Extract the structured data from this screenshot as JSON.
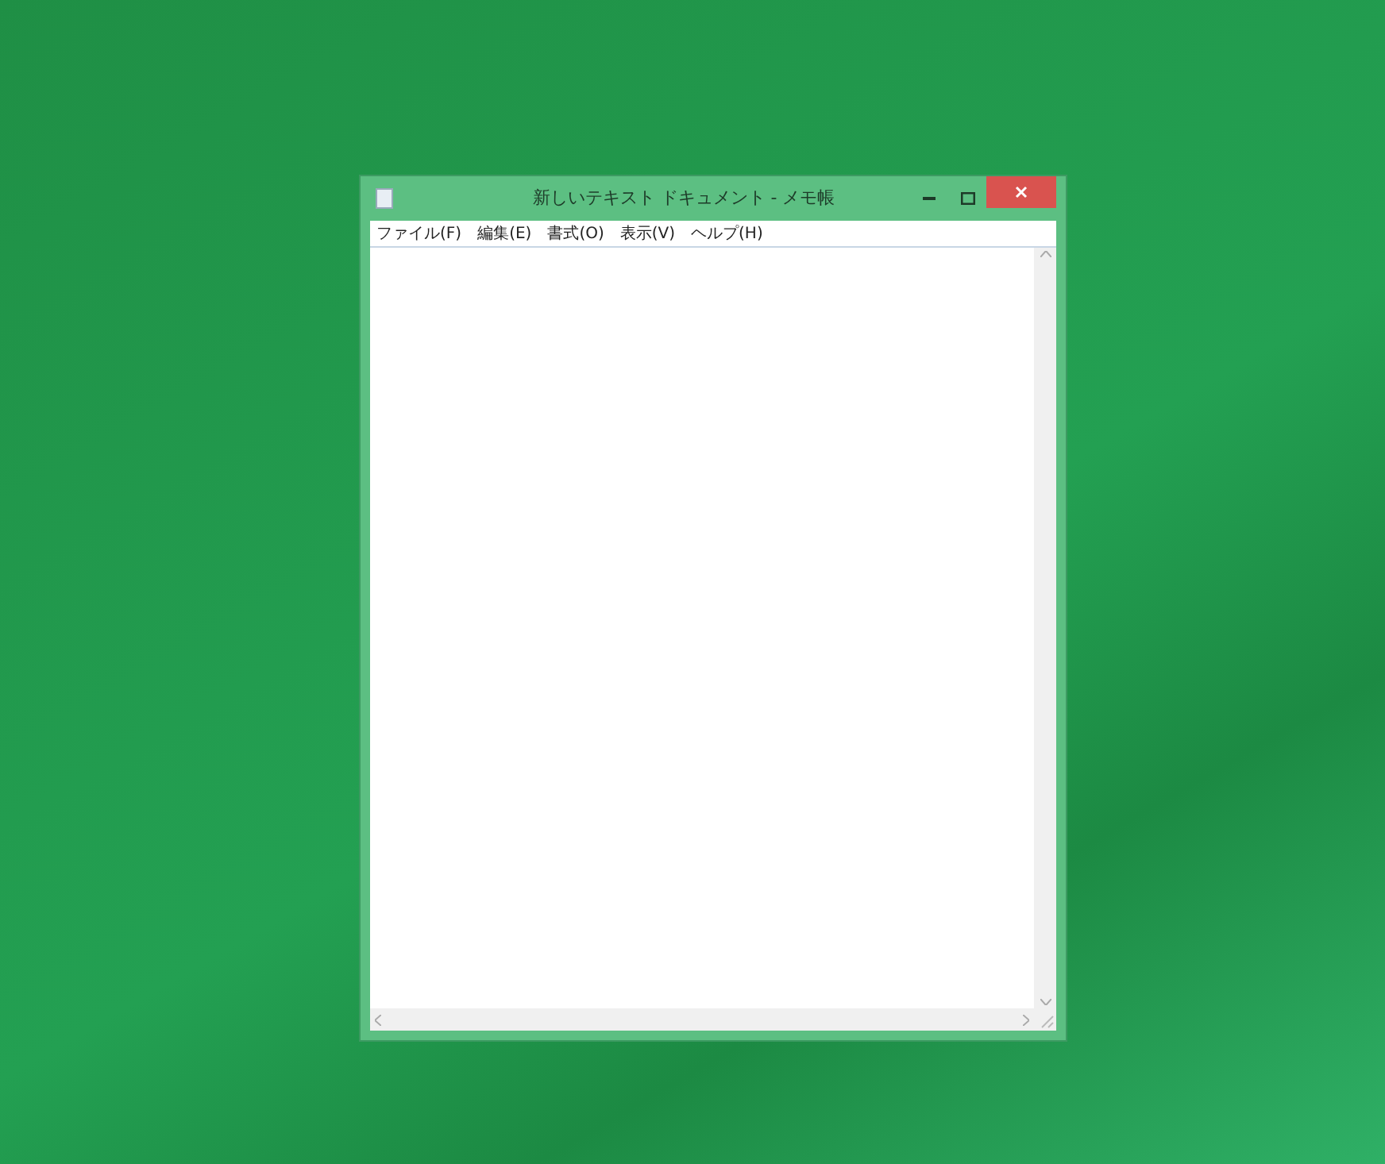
{
  "window": {
    "title": "新しいテキスト ドキュメント - メモ帳"
  },
  "menu": [
    "ファイル(F)",
    "編集(E)",
    "書式(O)",
    "表示(V)",
    "ヘルプ(H)"
  ]
}
